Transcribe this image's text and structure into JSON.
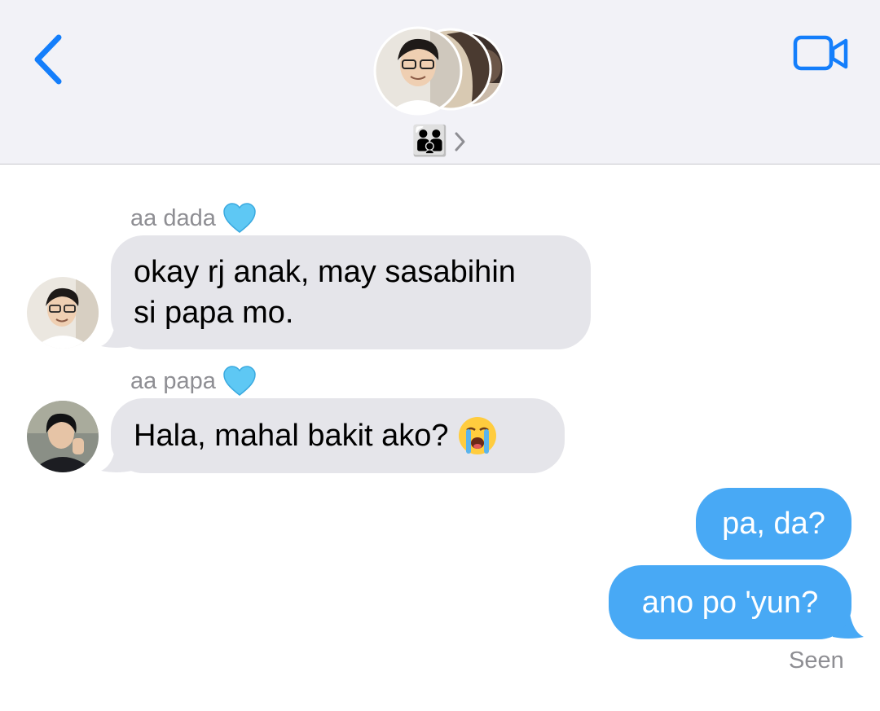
{
  "header": {
    "group_emoji": "👨‍👨‍👦",
    "chevron": "›",
    "back_icon": "chevron-left-icon",
    "video_icon": "video-camera-icon",
    "accent_color": "#147efb"
  },
  "messages": [
    {
      "sender": "aa dada",
      "sender_emoji": "💙",
      "lines": [
        "okay rj anak, may sasabihin",
        "si papa mo."
      ],
      "direction": "incoming"
    },
    {
      "sender": "aa papa",
      "sender_emoji": "💙",
      "text": "Hala, mahal bakit ako?",
      "emoji": "😭",
      "direction": "incoming"
    },
    {
      "text": "pa, da?",
      "direction": "outgoing"
    },
    {
      "text": "ano po 'yun?",
      "direction": "outgoing"
    }
  ],
  "status": {
    "seen_label": "Seen"
  },
  "colors": {
    "incoming_bubble": "#e5e5ea",
    "outgoing_bubble": "#48a9f5",
    "header_bg": "#f2f2f7",
    "meta_text": "#8e8e93"
  }
}
